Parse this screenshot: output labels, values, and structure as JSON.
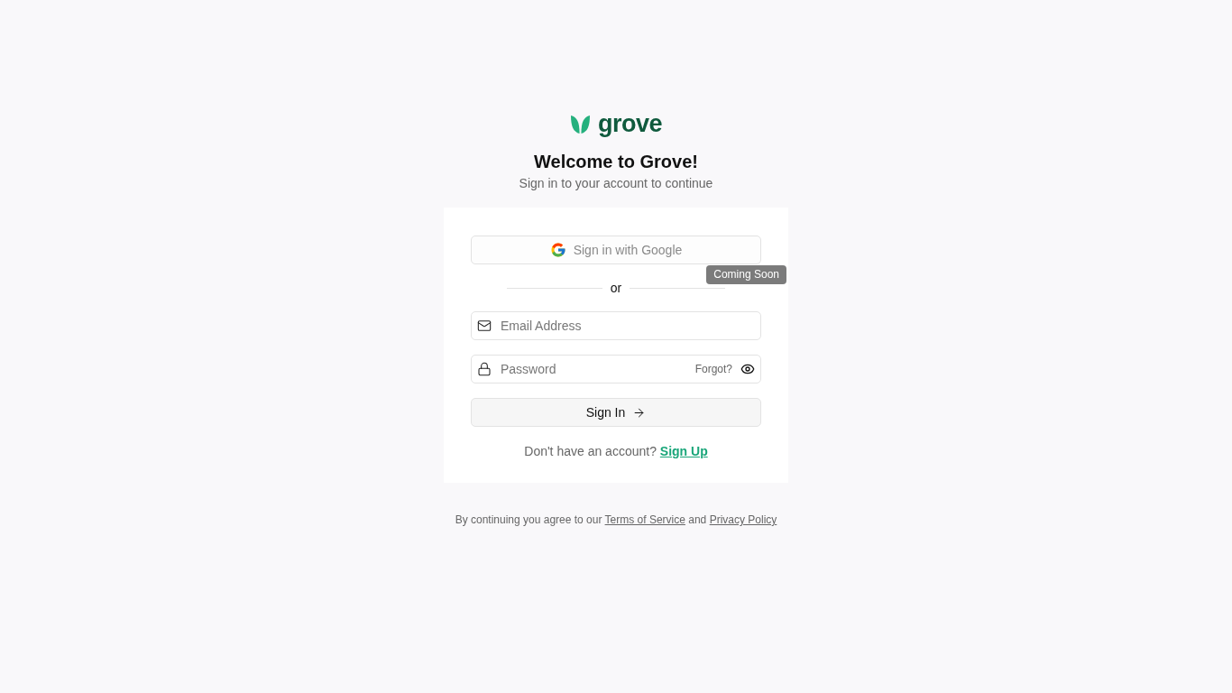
{
  "logo": {
    "text": "grove"
  },
  "heading": "Welcome to Grove!",
  "subtitle": "Sign in to your account to continue",
  "google_button": {
    "label": "Sign in with Google",
    "disabled": true,
    "tooltip": "Coming Soon"
  },
  "divider": "or",
  "email_field": {
    "placeholder": "Email Address"
  },
  "password_field": {
    "placeholder": "Password",
    "forgot_link": "Forgot?"
  },
  "sign_in_button": {
    "label": "Sign In"
  },
  "signup_prompt": {
    "text": "Don't have an account?",
    "link": "Sign Up"
  },
  "footer": {
    "text_1": "By continuing you agree to our",
    "link_1": "Terms of Service",
    "text_2": "and",
    "link_2": "Privacy Policy"
  }
}
